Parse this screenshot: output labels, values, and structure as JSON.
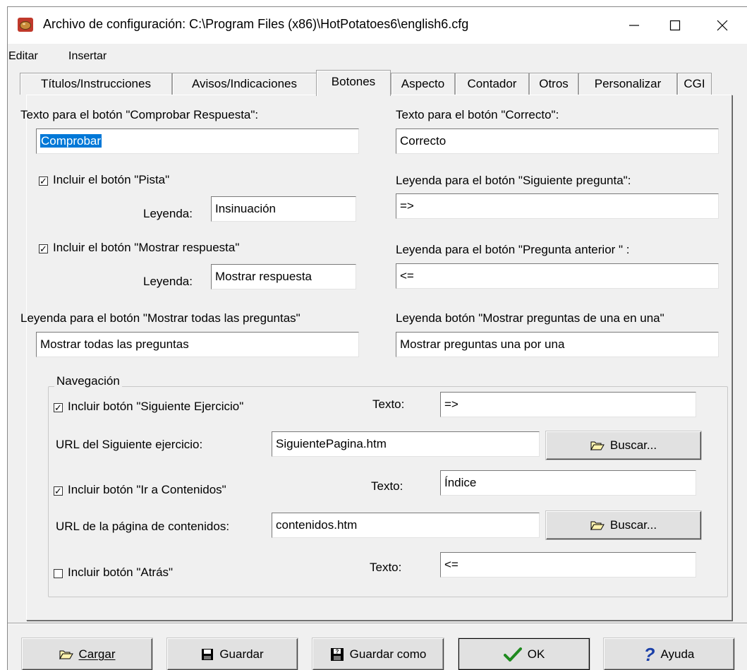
{
  "window": {
    "title": "Archivo de configuración: C:\\Program Files (x86)\\HotPotatoes6\\english6.cfg",
    "controls": {
      "minimize": "—",
      "maximize": "☐",
      "close": "✕"
    }
  },
  "menu": [
    "Editar",
    "Insertar"
  ],
  "tabs": [
    {
      "label": "Títulos/Instrucciones"
    },
    {
      "label": "Avisos/Indicaciones"
    },
    {
      "label": "Botones",
      "active": true
    },
    {
      "label": "Aspecto"
    },
    {
      "label": "Contador"
    },
    {
      "label": "Otros"
    },
    {
      "label": "Personalizar"
    },
    {
      "label": "CGI"
    }
  ],
  "buttons_tab": {
    "check_label": "Texto para el botón \"Comprobar Respuesta\":",
    "check_value": "Comprobar",
    "correct_label": "Texto para el botón \"Correcto\":",
    "correct_value": "Correcto",
    "hint_checkbox": "Incluir el botón \"Pista\"",
    "hint_checked": true,
    "hint_caption_label": "Leyenda:",
    "hint_caption_value": "Insinuación",
    "next_q_label": "Leyenda para el botón \"Siguiente pregunta\":",
    "next_q_value": "=>",
    "show_answer_checkbox": "Incluir el botón \"Mostrar respuesta\"",
    "show_answer_checked": true,
    "show_answer_caption_label": "Leyenda:",
    "show_answer_caption_value": "Mostrar respuesta",
    "prev_q_label": "Leyenda para el botón \"Pregunta anterior \" :",
    "prev_q_value": "<=",
    "show_all_label": "Leyenda para el botón \"Mostrar todas las preguntas\"",
    "show_all_value": "Mostrar todas las preguntas",
    "one_by_one_label": "Leyenda botón \"Mostrar preguntas de una en una\"",
    "one_by_one_value": "Mostrar preguntas una por una"
  },
  "navigation": {
    "legend": "Navegación",
    "next_ex_checkbox": "Incluir botón \"Siguiente Ejercicio\"",
    "next_ex_checked": true,
    "next_ex_text_label": "Texto:",
    "next_ex_text_value": "=>",
    "next_ex_url_label": "URL del Siguiente ejercicio:",
    "next_ex_url_value": "SiguientePagina.htm",
    "browse_label": "Buscar...",
    "contents_checkbox": "Incluir botón \"Ir a Contenidos\"",
    "contents_checked": true,
    "contents_text_label": "Texto:",
    "contents_text_value": "Índice",
    "contents_url_label": "URL de la página de contenidos:",
    "contents_url_value": "contenidos.htm",
    "back_checkbox": "Incluir botón \"Atrás\"",
    "back_checked": false,
    "back_text_label": "Texto:",
    "back_text_value": "<="
  },
  "footer": {
    "load": "Cargar",
    "save": "Guardar",
    "save_as": "Guardar como",
    "ok": "OK",
    "help": "Ayuda"
  },
  "colors": {
    "selection": "#0078d7",
    "window_bg": "#f0f0f0",
    "ok_check": "#1f8a1f",
    "help_icon": "#1a3fa8"
  }
}
